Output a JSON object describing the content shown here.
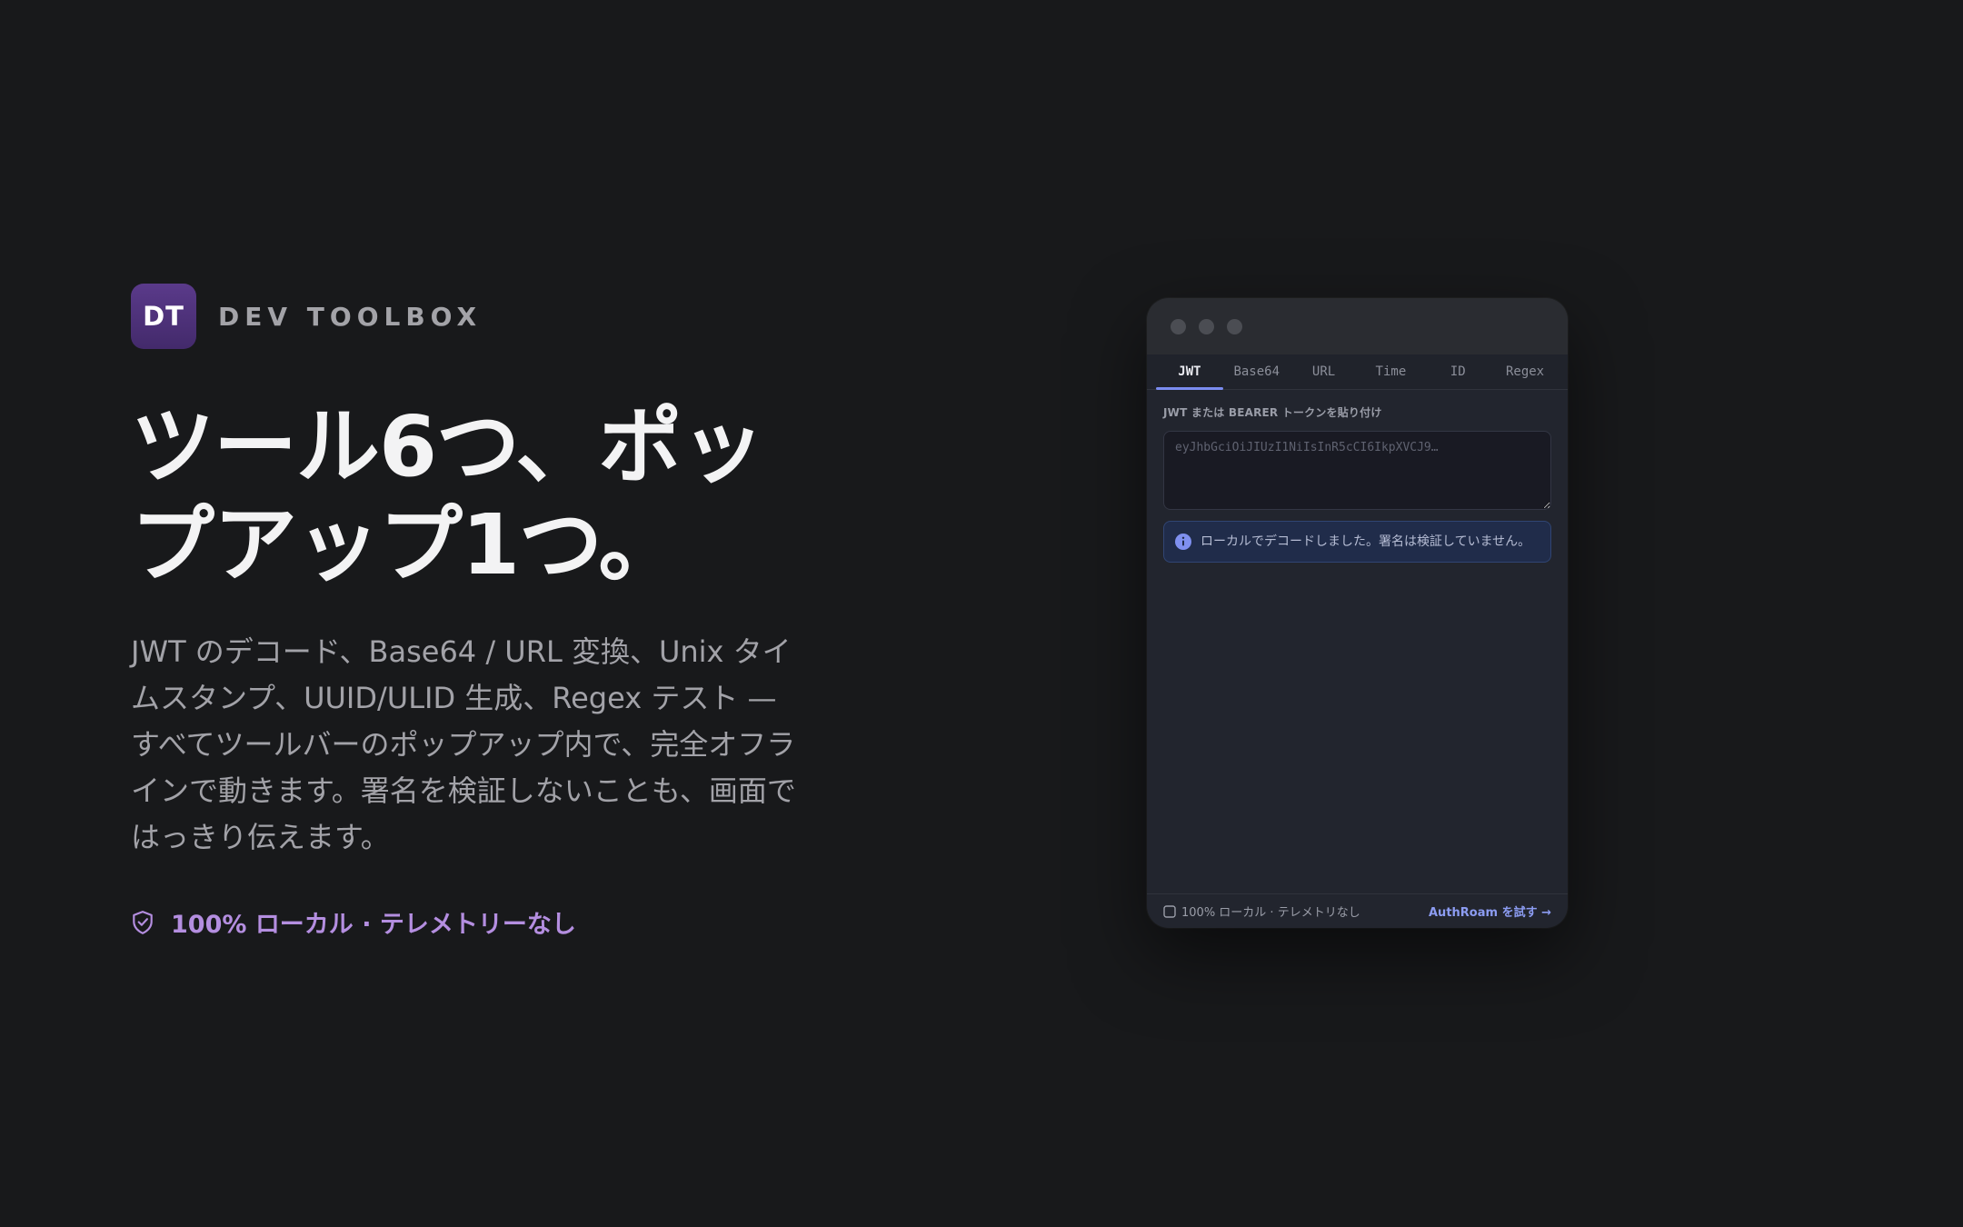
{
  "brand": {
    "logo_text": "DT",
    "name": "DEV TOOLBOX"
  },
  "hero": {
    "headline": "ツール6つ、ポップアップ1つ。",
    "description": "JWT のデコード、Base64 / URL 変換、Unix タイムスタンプ、UUID/ULID 生成、Regex テスト — すべてツールバーのポップアップ内で、完全オフラインで動きます。署名を検証しないことも、画面ではっきり伝えます。",
    "local_badge": "100% ローカル · テレメトリーなし"
  },
  "popup": {
    "tabs": [
      {
        "label": "JWT",
        "active": true
      },
      {
        "label": "Base64",
        "active": false
      },
      {
        "label": "URL",
        "active": false
      },
      {
        "label": "Time",
        "active": false
      },
      {
        "label": "ID",
        "active": false
      },
      {
        "label": "Regex",
        "active": false
      }
    ],
    "input_label": "JWT または BEARER トークンを貼り付け",
    "input_placeholder": "eyJhbGciOiJIUzI1NiIsInR5cCI6IkpXVCJ9…",
    "input_value": "",
    "notice": "ローカルでデコードしました。署名は検証していません。",
    "footer_left": "100% ローカル · テレメトリなし",
    "footer_link": "AuthRoam を試す →"
  },
  "colors": {
    "background": "#18191b",
    "accent": "#b48ee0",
    "tab_indicator": "#7b8cf0",
    "info": "#8c9cf2"
  }
}
